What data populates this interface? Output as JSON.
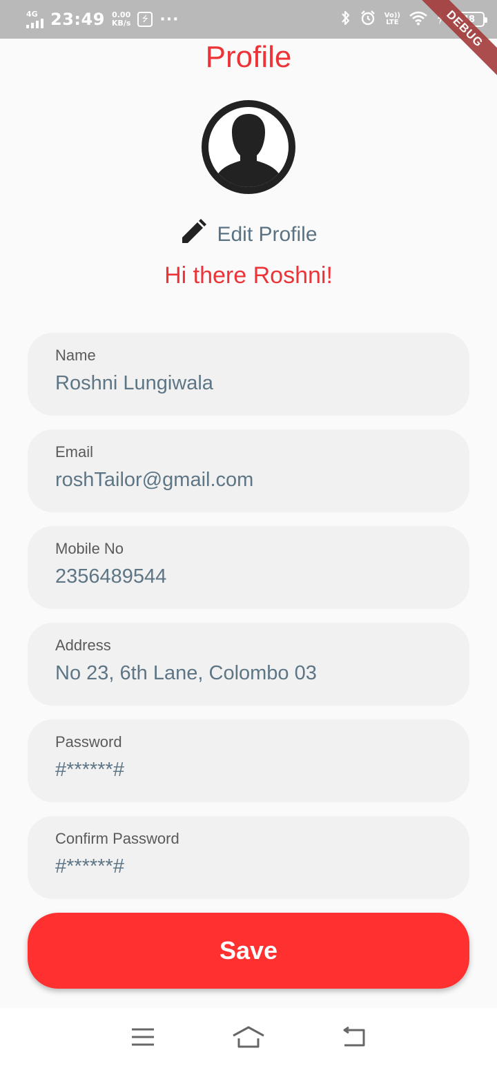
{
  "status_bar": {
    "network": "4G",
    "time": "23:49",
    "speed_value": "0.00",
    "speed_unit": "KB/s",
    "more": "···",
    "volte_top": "Vo))",
    "volte_bottom": "LTE",
    "battery": "48",
    "debug_label": "DEBUG"
  },
  "page": {
    "title": "Profile",
    "edit_profile_label": "Edit Profile",
    "greeting": "Hi there Roshni!"
  },
  "fields": {
    "name": {
      "label": "Name",
      "value": "Roshni Lungiwala"
    },
    "email": {
      "label": "Email",
      "value": "roshTailor@gmail.com"
    },
    "mobile": {
      "label": "Mobile No",
      "value": "2356489544"
    },
    "address": {
      "label": "Address",
      "value": "No 23, 6th Lane, Colombo 03"
    },
    "password": {
      "label": "Password",
      "value": "#******#"
    },
    "confirm_password": {
      "label": "Confirm Password",
      "value": "#******#"
    }
  },
  "save_label": "Save",
  "colors": {
    "accent": "#ec3438",
    "button": "#ff3030",
    "field_bg": "#f1f1f1",
    "value_text": "#5d7585"
  },
  "icons": [
    "signal-icon",
    "usb-icon",
    "bluetooth-icon",
    "alarm-icon",
    "wifi-icon",
    "charging-icon",
    "battery-icon",
    "avatar-icon",
    "pencil-icon",
    "menu-icon",
    "home-icon",
    "back-icon"
  ]
}
